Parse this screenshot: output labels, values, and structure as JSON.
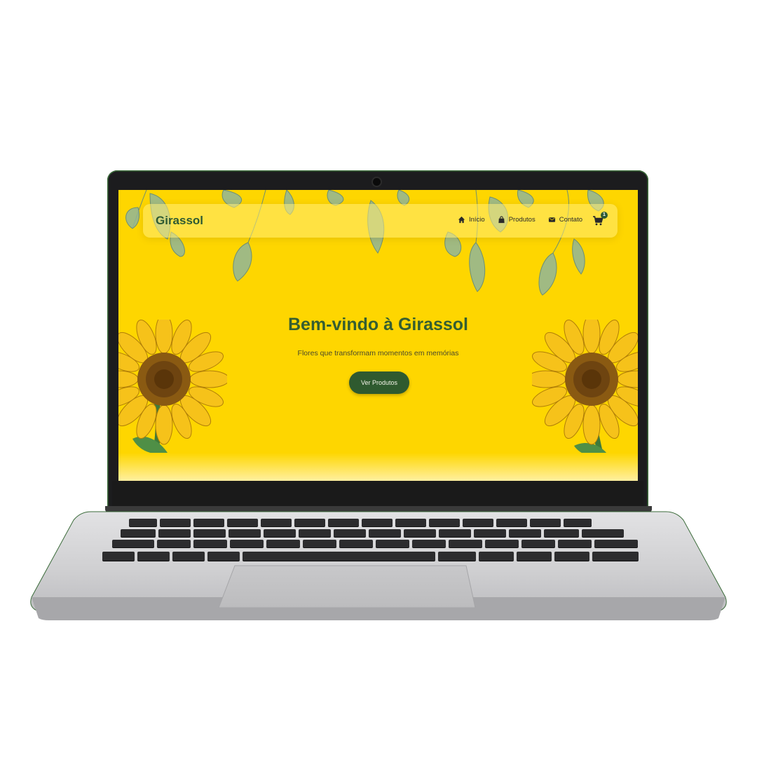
{
  "site": {
    "brand": "Girassol",
    "nav": {
      "home_label": "Início",
      "products_label": "Produtos",
      "contact_label": "Contato",
      "cart_count": "1"
    },
    "hero": {
      "title": "Bem-vindo à Girassol",
      "subtitle": "Flores que transformam momentos em memórias",
      "cta_label": "Ver Produtos"
    }
  },
  "icons": {
    "home": "home-icon",
    "products": "shopping-bag-icon",
    "contact": "envelope-icon",
    "cart": "shopping-cart-icon",
    "decor_left": "sunflower-illustration",
    "decor_right": "sunflower-illustration",
    "decor_top": "hanging-leaves-illustration"
  },
  "colors": {
    "hero_background": "#fed600",
    "brand_green": "#2e5a33",
    "button_green": "#2f5a2f",
    "laptop_bezel": "#1c1c1e",
    "laptop_body": "#d4d4d6"
  }
}
